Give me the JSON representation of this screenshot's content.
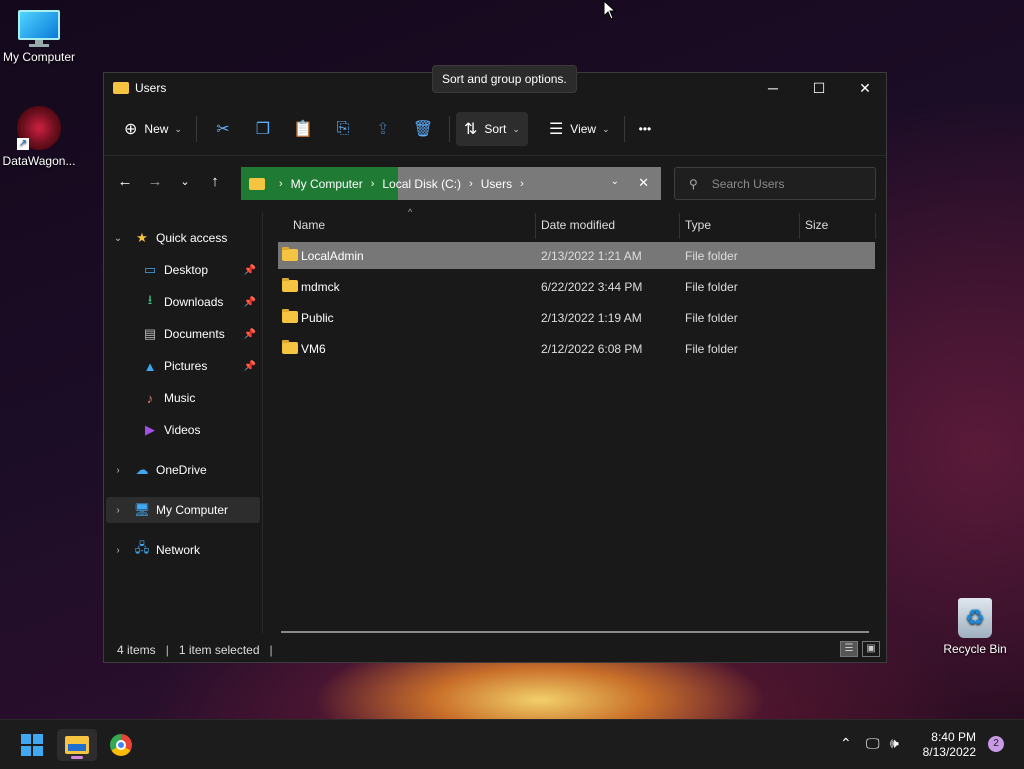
{
  "desktop": {
    "icons": [
      {
        "label": "My Computer",
        "icon": "monitor-icon"
      },
      {
        "label": "DataWagon...",
        "icon": "datawagon-shortcut-icon"
      },
      {
        "label": "Recycle Bin",
        "icon": "recycle-bin-icon"
      }
    ]
  },
  "window": {
    "title": "Users",
    "tooltip": "Sort and group options.",
    "controls": {
      "minimize": "─",
      "maximize": "☐",
      "close": "✕"
    }
  },
  "toolbar": {
    "new_label": "New",
    "sort_label": "Sort",
    "view_label": "View",
    "more_label": "•••",
    "icons": [
      "cut-icon",
      "copy-icon",
      "paste-icon",
      "rename-icon",
      "share-icon",
      "delete-icon"
    ]
  },
  "address": {
    "crumbs": [
      "My Computer",
      "Local Disk (C:)",
      "Users"
    ],
    "search_placeholder": "Search Users"
  },
  "sidebar": {
    "items": [
      {
        "label": "Quick access",
        "icon": "star-icon"
      },
      {
        "label": "Desktop",
        "icon": "desktop-icon",
        "pinned": true
      },
      {
        "label": "Downloads",
        "icon": "download-icon",
        "pinned": true
      },
      {
        "label": "Documents",
        "icon": "documents-icon",
        "pinned": true
      },
      {
        "label": "Pictures",
        "icon": "pictures-icon",
        "pinned": true
      },
      {
        "label": "Music",
        "icon": "music-icon"
      },
      {
        "label": "Videos",
        "icon": "videos-icon"
      },
      {
        "label": "OneDrive",
        "icon": "cloud-icon"
      },
      {
        "label": "My Computer",
        "icon": "computer-icon"
      },
      {
        "label": "Network",
        "icon": "network-icon"
      }
    ]
  },
  "list": {
    "columns": [
      "Name",
      "Date modified",
      "Type",
      "Size"
    ],
    "rows": [
      {
        "name": "LocalAdmin",
        "date": "2/13/2022 1:21 AM",
        "type": "File folder",
        "size": "",
        "selected": true
      },
      {
        "name": "mdmck",
        "date": "6/22/2022 3:44 PM",
        "type": "File folder",
        "size": ""
      },
      {
        "name": "Public",
        "date": "2/13/2022 1:19 AM",
        "type": "File folder",
        "size": ""
      },
      {
        "name": "VM6",
        "date": "2/12/2022 6:08 PM",
        "type": "File folder",
        "size": ""
      }
    ]
  },
  "status": {
    "item_count": "4 items",
    "selected": "1 item selected"
  },
  "taskbar": {
    "time": "8:40 PM",
    "date": "8/13/2022",
    "notifications": "2"
  },
  "colors": {
    "selected_row": "#777777",
    "accent": "#5eaefc",
    "folder": "#f5c542"
  }
}
